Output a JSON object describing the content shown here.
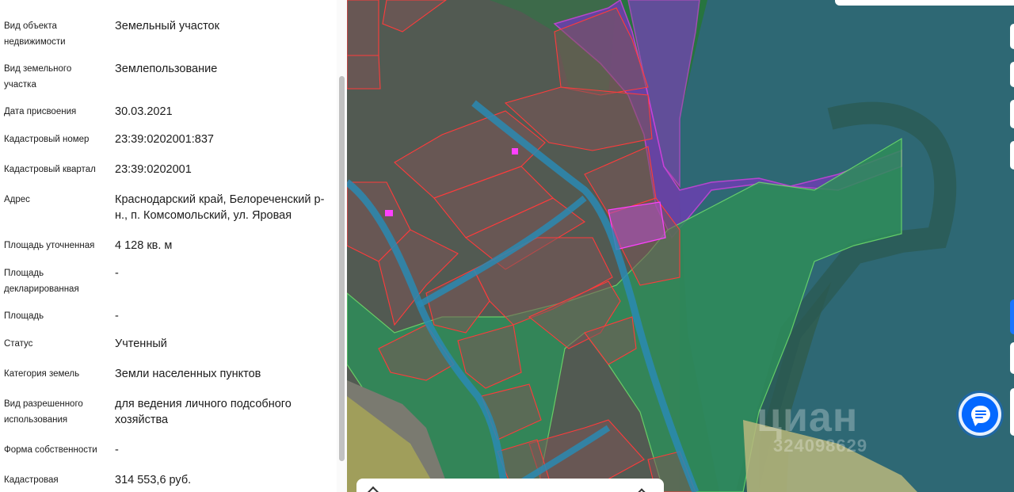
{
  "property": {
    "rows": [
      {
        "label": "Вид объекта недвижимости",
        "value": "Земельный участок"
      },
      {
        "label": "Вид земельного участка",
        "value": "Землепользование"
      },
      {
        "label": "Дата присвоения",
        "value": "30.03.2021"
      },
      {
        "label": "Кадастровый номер",
        "value": "23:39:0202001:837"
      },
      {
        "label": "Кадастровый квартал",
        "value": "23:39:0202001"
      },
      {
        "label": "Адрес",
        "value": "Краснодарский край, Белореченский р-н., п. Комсомольский, ул. Яровая"
      },
      {
        "label": "Площадь уточненная",
        "value": "4 128 кв. м"
      },
      {
        "label": "Площадь декларированная",
        "value": "-"
      },
      {
        "label": "Площадь",
        "value": "-"
      },
      {
        "label": "Статус",
        "value": "Учтенный"
      },
      {
        "label": "Категория земель",
        "value": "Земли населенных пунктов"
      },
      {
        "label": "Вид разрешенного использования",
        "value": "для ведения личного подсобного хозяйства"
      },
      {
        "label": "Форма собственности",
        "value": "-"
      },
      {
        "label": "Кадастровая",
        "value": "314 553,6 руб."
      }
    ]
  },
  "map": {
    "watermark_logo": "циан",
    "watermark_id": "324098629",
    "chat_icon": "chat-icon",
    "colors": {
      "parcel_outline": "#ff3b3b",
      "settlement_zone": "#39c46a",
      "forest_zone": "#2e8fb0",
      "protected_zone": "#8a2be2",
      "chat_button": "#0468ff"
    }
  }
}
